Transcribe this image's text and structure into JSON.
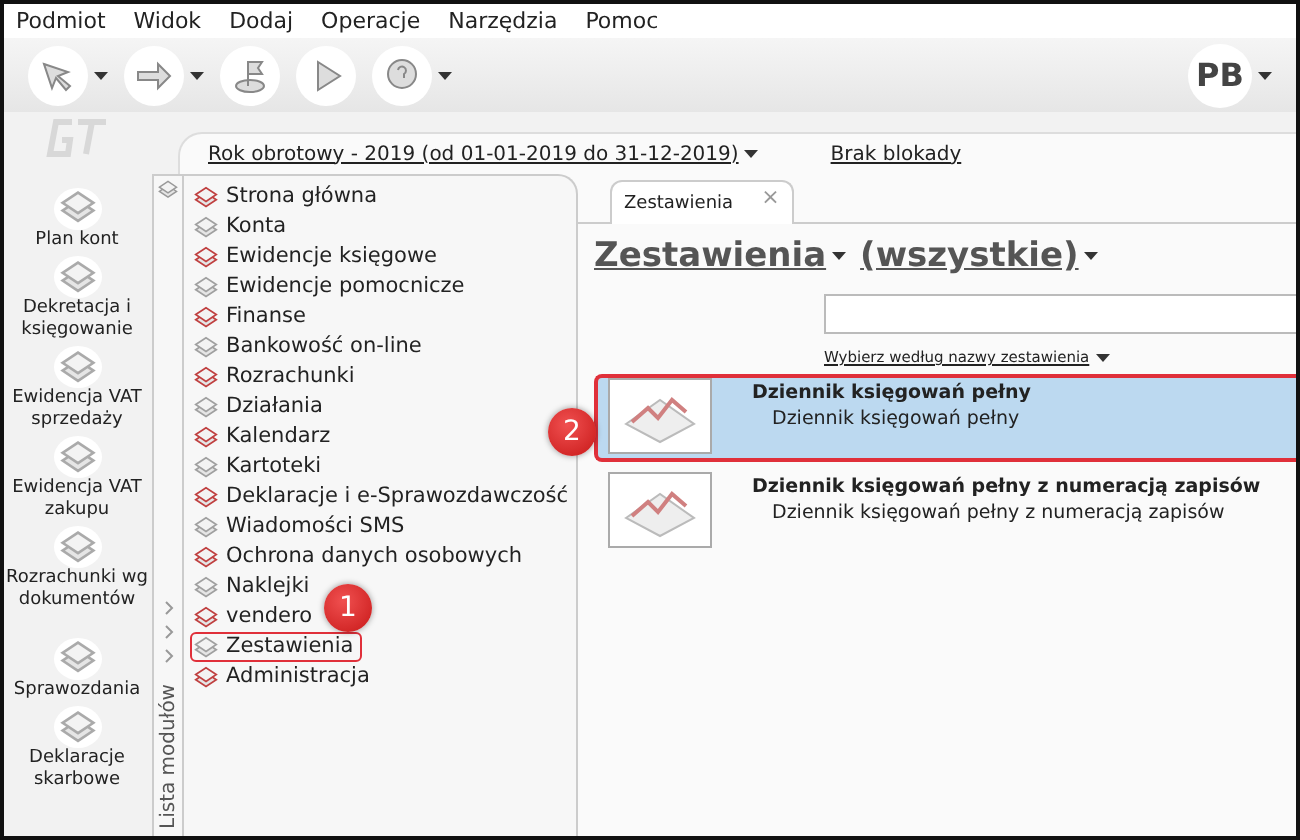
{
  "menu": [
    "Podmiot",
    "Widok",
    "Dodaj",
    "Operacje",
    "Narzędzia",
    "Pomoc"
  ],
  "user_badge": "PB",
  "period": {
    "label": "Rok obrotowy - 2019  (od 01-01-2019 do 31-12-2019)",
    "lock": "Brak blokady"
  },
  "shortcuts": [
    "Plan kont",
    "Dekretacja i księgowanie",
    "Ewidencja VAT sprzedaży",
    "Ewidencja VAT zakupu",
    "Rozrachunki wg dokumentów",
    "Sprawozdania",
    "Deklaracje skarbowe"
  ],
  "modules": {
    "side_label": "Lista modułów",
    "items": [
      {
        "label": "Strona główna",
        "selected": false
      },
      {
        "label": "Konta",
        "selected": false
      },
      {
        "label": "Ewidencje księgowe",
        "selected": false
      },
      {
        "label": "Ewidencje pomocnicze",
        "selected": false
      },
      {
        "label": "Finanse",
        "selected": false
      },
      {
        "label": "Bankowość on-line",
        "selected": false
      },
      {
        "label": "Rozrachunki",
        "selected": false
      },
      {
        "label": "Działania",
        "selected": false
      },
      {
        "label": "Kalendarz",
        "selected": false
      },
      {
        "label": "Kartoteki",
        "selected": false
      },
      {
        "label": "Deklaracje i e-Sprawozdawczość",
        "selected": false
      },
      {
        "label": "Wiadomości SMS",
        "selected": false
      },
      {
        "label": "Ochrona danych osobowych",
        "selected": false
      },
      {
        "label": "Naklejki",
        "selected": false
      },
      {
        "label": "vendero",
        "selected": false
      },
      {
        "label": "Zestawienia",
        "selected": true
      },
      {
        "label": "Administracja",
        "selected": false
      }
    ]
  },
  "tab": {
    "label": "Zestawienia",
    "close": "×"
  },
  "heading": {
    "category": "Zestawienia",
    "filter": "(wszystkie)"
  },
  "sort_link": "Wybierz według nazwy zestawienia",
  "reports": [
    {
      "title": "Dziennik księgowań pełny",
      "description": "Dziennik księgowań pełny",
      "selected": true
    },
    {
      "title": "Dziennik księgowań pełny z numeracją zapisów",
      "description": "Dziennik księgowań pełny z numeracją zapisów",
      "selected": false
    }
  ],
  "callouts": [
    "1",
    "2"
  ]
}
